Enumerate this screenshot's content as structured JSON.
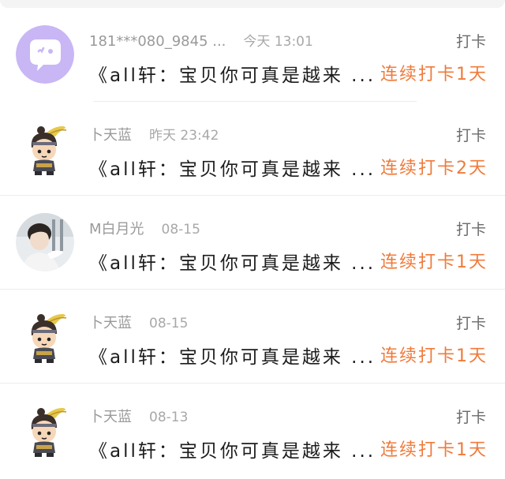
{
  "items": [
    {
      "avatar_icon": "purple-chat-bubble-icon",
      "name": "181***080_9845 ...",
      "time": "今天 13:01",
      "type": "打卡",
      "content": "《all轩：宝贝你可真是越来 ...",
      "streak": "连续打卡1天"
    },
    {
      "avatar_icon": "cartoon-ninja-icon",
      "name": "卜天蓝",
      "time": "昨天 23:42",
      "type": "打卡",
      "content": "《all轩：宝贝你可真是越来 ...",
      "streak": "连续打卡2天"
    },
    {
      "avatar_icon": "photo-avatar",
      "name": "M白月光",
      "time": "08-15",
      "type": "打卡",
      "content": "《all轩：宝贝你可真是越来 ...",
      "streak": "连续打卡1天"
    },
    {
      "avatar_icon": "cartoon-ninja-icon",
      "name": "卜天蓝",
      "time": "08-15",
      "type": "打卡",
      "content": "《all轩：宝贝你可真是越来 ...",
      "streak": "连续打卡1天"
    },
    {
      "avatar_icon": "cartoon-ninja-icon",
      "name": "卜天蓝",
      "time": "08-13",
      "type": "打卡",
      "content": "《all轩：宝贝你可真是越来 ...",
      "streak": "连续打卡1天"
    }
  ],
  "colors": {
    "streak": "#f07a3a",
    "avatar_purple": "#c9b6f5"
  }
}
